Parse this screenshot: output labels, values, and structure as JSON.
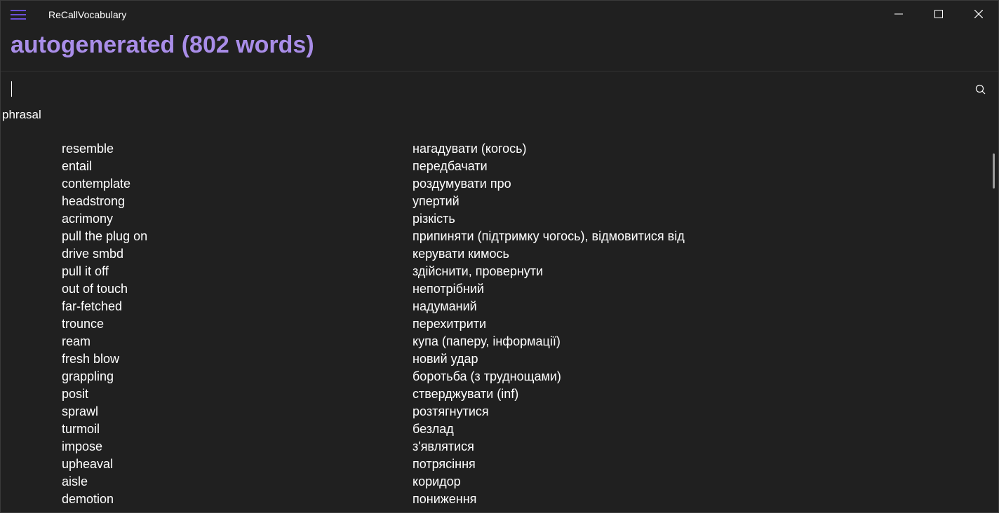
{
  "app": {
    "title": "ReCallVocabulary"
  },
  "header": {
    "title": "autogenerated (802 words)"
  },
  "search": {
    "value": "",
    "placeholder": ""
  },
  "section": {
    "label": "phrasal"
  },
  "words": [
    {
      "en": "resemble",
      "ua": "нагадувати (когось)"
    },
    {
      "en": "entail",
      "ua": "передбачати"
    },
    {
      "en": "contemplate",
      "ua": "роздумувати про"
    },
    {
      "en": "headstrong",
      "ua": "упертий"
    },
    {
      "en": "acrimony",
      "ua": "різкість"
    },
    {
      "en": "pull the plug on",
      "ua": "припиняти (підтримку чогось), відмовитися від"
    },
    {
      "en": "drive smbd",
      "ua": "керувати кимось"
    },
    {
      "en": "pull it off",
      "ua": "здійснити, провернути"
    },
    {
      "en": "out of touch",
      "ua": "непотрібний"
    },
    {
      "en": "far-fetched",
      "ua": "надуманий"
    },
    {
      "en": "trounce",
      "ua": "перехитрити"
    },
    {
      "en": "ream",
      "ua": "купа (паперу, інформації)"
    },
    {
      "en": "fresh blow",
      "ua": "новий удар"
    },
    {
      "en": "grappling",
      "ua": "боротьба (з труднощами)"
    },
    {
      "en": "posit",
      "ua": "стверджувати (inf)"
    },
    {
      "en": "sprawl",
      "ua": "розтягнутися"
    },
    {
      "en": "turmoil",
      "ua": "безлад"
    },
    {
      "en": "impose",
      "ua": "з'являтися"
    },
    {
      "en": "upheaval",
      "ua": "потрясіння"
    },
    {
      "en": "aisle",
      "ua": "коридор"
    },
    {
      "en": "demotion",
      "ua": "пониження"
    }
  ],
  "icons": {
    "menu": "hamburger-menu-icon",
    "minimize": "minimize-icon",
    "maximize": "maximize-icon",
    "close": "close-icon",
    "search": "search-icon"
  },
  "colors": {
    "accent": "#a98de8",
    "menu_accent": "#6b4fd8",
    "background": "#202020",
    "text": "#ffffff"
  }
}
